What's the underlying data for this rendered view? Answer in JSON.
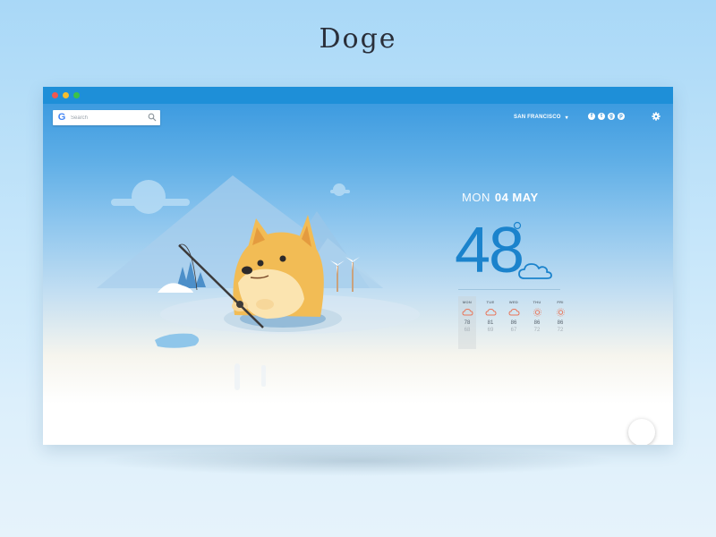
{
  "page": {
    "title": "Doge"
  },
  "search": {
    "placeholder": "Search",
    "logo": "G"
  },
  "location": {
    "label": "SAN FRANCISCO"
  },
  "social": [
    "f",
    "t",
    "g",
    "p"
  ],
  "weather": {
    "day": "MON",
    "date": "04 MAY",
    "temperature": "48",
    "condition_icon": "cloud-icon"
  },
  "forecast": [
    {
      "day": "MON",
      "icon": "cloud-icon",
      "high": "78",
      "low": "68"
    },
    {
      "day": "TUE",
      "icon": "cloud-icon",
      "high": "81",
      "low": "69"
    },
    {
      "day": "WED",
      "icon": "cloud-icon",
      "high": "86",
      "low": "67"
    },
    {
      "day": "THU",
      "icon": "sun-icon",
      "high": "86",
      "low": "72"
    },
    {
      "day": "FRI",
      "icon": "sun-icon",
      "high": "86",
      "low": "72"
    }
  ],
  "colors": {
    "titlebar": "#1e8fd8",
    "accent": "#1b83cc",
    "forecast_icon": "#e8765a"
  }
}
